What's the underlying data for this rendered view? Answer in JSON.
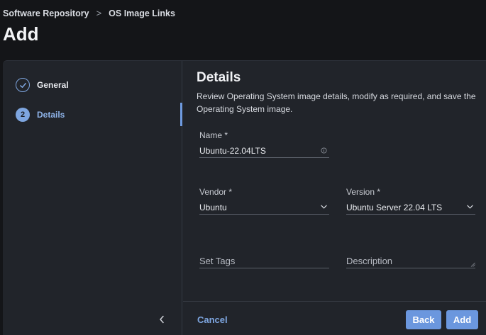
{
  "breadcrumb": {
    "items": [
      "Software Repository",
      "OS Image Links"
    ],
    "separator": ">"
  },
  "page": {
    "title": "Add"
  },
  "steps": [
    {
      "number": "1",
      "label": "General",
      "status": "done"
    },
    {
      "number": "2",
      "label": "Details",
      "status": "active"
    }
  ],
  "details": {
    "title": "Details",
    "description": "Review Operating System image details, modify as required, and save the Operating System image.",
    "name": {
      "label": "Name *",
      "value": "Ubuntu-22.04LTS"
    },
    "vendor": {
      "label": "Vendor *",
      "value": "Ubuntu"
    },
    "version": {
      "label": "Version *",
      "value": "Ubuntu Server 22.04 LTS"
    },
    "tags": {
      "placeholder": "Set Tags"
    },
    "description_field": {
      "placeholder": "Description"
    }
  },
  "footer": {
    "cancel_label": "Cancel",
    "back_label": "Back",
    "add_label": "Add"
  },
  "colors": {
    "accent": "#6b97de",
    "link": "#7ea6e0",
    "background": "#141518",
    "panel": "#21242a"
  }
}
